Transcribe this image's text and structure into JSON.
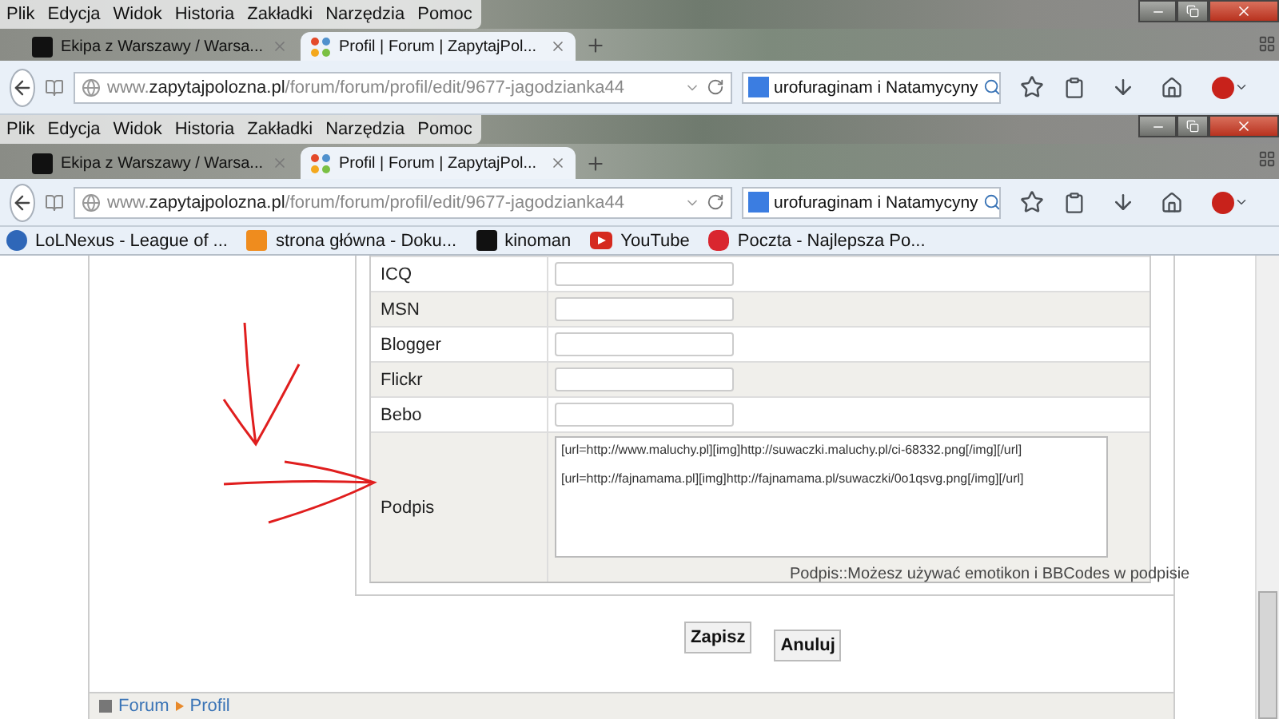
{
  "browser_chrome": [
    {
      "menu": [
        "Plik",
        "Edycja",
        "Widok",
        "Historia",
        "Zakładki",
        "Narzędzia",
        "Pomoc"
      ],
      "tabs": [
        {
          "title": "Ekipa z Warszawy / Warsa...",
          "selected": false
        },
        {
          "title": "Profil | Forum | ZapytajPol...",
          "selected": true
        }
      ],
      "url": {
        "prefix": "www.",
        "domain": "zapytajpolozna.pl",
        "path": "/forum/forum/profil/edit/9677-jagodzianka44"
      },
      "search": {
        "value": "urofuraginam i Natamycyny"
      }
    },
    {
      "menu": [
        "Plik",
        "Edycja",
        "Widok",
        "Historia",
        "Zakładki",
        "Narzędzia",
        "Pomoc"
      ],
      "tabs": [
        {
          "title": "Ekipa z Warszawy / Warsa...",
          "selected": false
        },
        {
          "title": "Profil | Forum | ZapytajPol...",
          "selected": true
        }
      ],
      "url": {
        "prefix": "www.",
        "domain": "zapytajpolozna.pl",
        "path": "/forum/forum/profil/edit/9677-jagodzianka44"
      },
      "search": {
        "value": "urofuraginam i Natamycyny"
      },
      "bookmarks": [
        {
          "title": "LoLNexus - League of ..."
        },
        {
          "title": "strona główna - Doku..."
        },
        {
          "title": "kinoman"
        },
        {
          "title": "YouTube"
        },
        {
          "title": "Poczta - Najlepsza Po..."
        }
      ]
    }
  ],
  "form": {
    "rows": [
      {
        "label": "ICQ",
        "kind": "text"
      },
      {
        "label": "MSN",
        "kind": "text"
      },
      {
        "label": "Blogger",
        "kind": "text"
      },
      {
        "label": "Flickr",
        "kind": "text"
      },
      {
        "label": "Bebo",
        "kind": "text"
      },
      {
        "label": "Podpis",
        "kind": "textarea",
        "value": "[url=http://www.maluchy.pl][img]http://suwaczki.maluchy.pl/ci-68332.png[/img][/url]\n\n[url=http://fajnamama.pl][img]http://fajnamama.pl/suwaczki/0o1qsvg.png[/img][/url]",
        "hint": "Podpis::Możesz używać emotikon i BBCodes w podpisie"
      }
    ]
  },
  "buttons": [
    "Zapisz",
    "Anuluj"
  ],
  "breadcrumb": [
    "Forum",
    "Profil"
  ]
}
